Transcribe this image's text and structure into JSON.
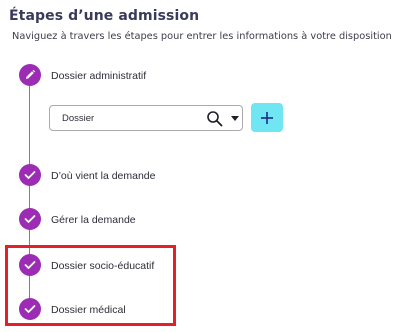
{
  "header": {
    "title": "Étapes d’une admission",
    "subtitle": "Naviguez à travers les étapes pour entrer les informations à votre disposition"
  },
  "steps": [
    {
      "label": "Dossier administratif",
      "state": "editing",
      "icon": "pencil-icon"
    },
    {
      "label": "D’où vient la demande",
      "state": "done",
      "icon": "check-icon"
    },
    {
      "label": "Gérer la demande",
      "state": "done",
      "icon": "check-icon"
    },
    {
      "label": "Dossier socio-éducatif",
      "state": "done",
      "icon": "check-icon"
    },
    {
      "label": "Dossier médical",
      "state": "done",
      "icon": "check-icon"
    }
  ],
  "dossier_select": {
    "value": "Dossier",
    "icons": [
      "search-icon",
      "caret-down-icon"
    ]
  },
  "add_button": {
    "icon": "plus-icon"
  },
  "colors": {
    "step_node": "#9b2cb3",
    "rail": "#7d74c9",
    "add_button_bg": "#6fe6f2",
    "highlight": "#e3202a",
    "title": "#3a3a5c"
  }
}
